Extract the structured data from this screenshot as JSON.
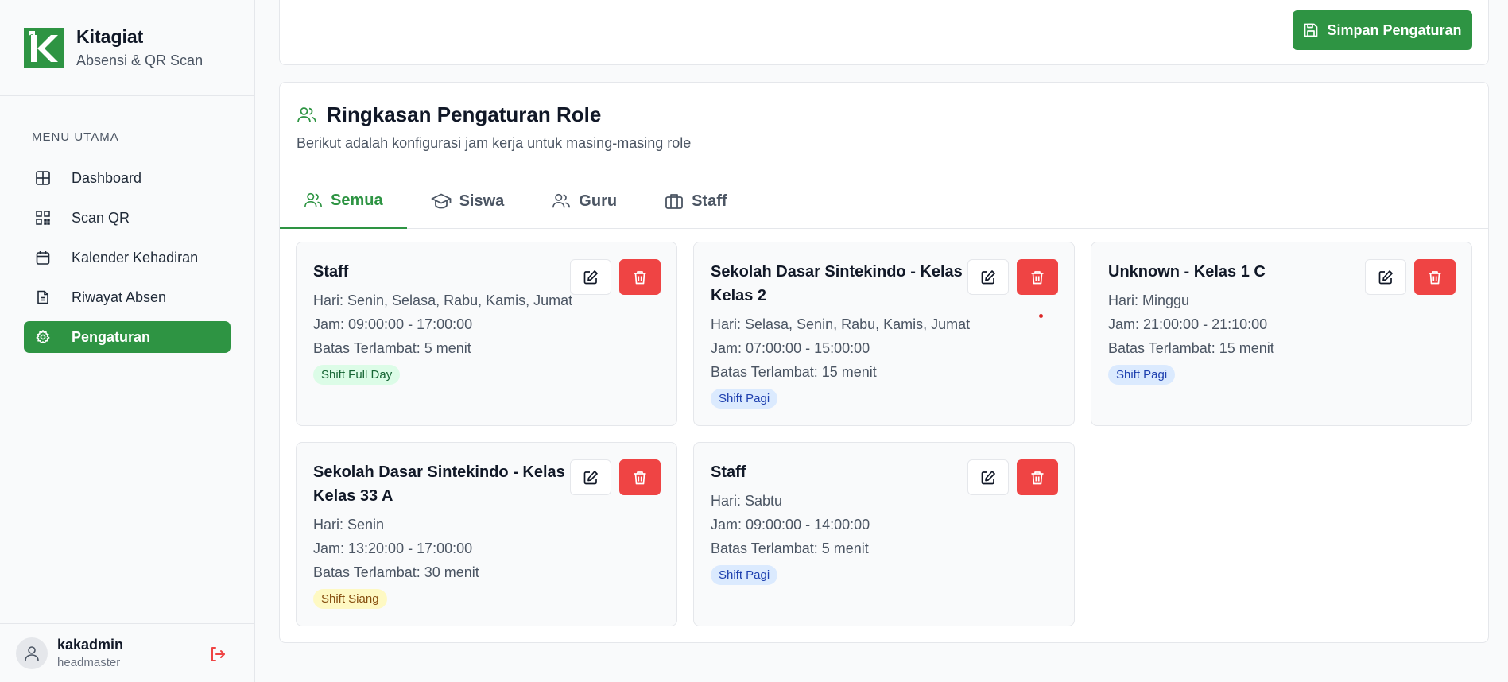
{
  "brand": {
    "name": "Kitagiat",
    "subtitle": "Absensi & QR Scan"
  },
  "menu": {
    "label": "MENU UTAMA",
    "items": [
      {
        "label": "Dashboard",
        "icon": "grid-icon"
      },
      {
        "label": "Scan QR",
        "icon": "qr-icon"
      },
      {
        "label": "Kalender Kehadiran",
        "icon": "calendar-icon"
      },
      {
        "label": "Riwayat Absen",
        "icon": "document-icon"
      },
      {
        "label": "Pengaturan",
        "icon": "gear-icon",
        "active": true
      }
    ]
  },
  "user": {
    "name": "kakadmin",
    "role": "headmaster"
  },
  "toolbar": {
    "save_label": "Simpan Pengaturan"
  },
  "summary": {
    "title": "Ringkasan Pengaturan Role",
    "description": "Berikut adalah konfigurasi jam kerja untuk masing-masing role",
    "tabs": [
      {
        "label": "Semua",
        "icon": "users-icon",
        "active": true
      },
      {
        "label": "Siswa",
        "icon": "graduation-cap-icon"
      },
      {
        "label": "Guru",
        "icon": "users-icon"
      },
      {
        "label": "Staff",
        "icon": "briefcase-icon"
      }
    ],
    "roles": [
      {
        "title": "Staff",
        "hari": "Hari: Senin, Selasa, Rabu, Kamis, Jumat",
        "jam": "Jam: 09:00:00 - 17:00:00",
        "batas": "Batas Terlambat: 5 menit",
        "badge": "Shift Full Day",
        "badge_color": "#dcfce7"
      },
      {
        "title": "Sekolah Dasar Sintekindo - Kelas Kelas 2",
        "hari": "Hari: Selasa, Senin, Rabu, Kamis, Jumat",
        "jam": "Jam: 07:00:00 - 15:00:00",
        "batas": "Batas Terlambat: 15 menit",
        "badge": "Shift Pagi",
        "badge_color": "#dbeafe"
      },
      {
        "title": "Unknown - Kelas 1 C",
        "hari": "Hari: Minggu",
        "jam": "Jam: 21:00:00 - 21:10:00",
        "batas": "Batas Terlambat: 15 menit",
        "badge": "Shift Pagi",
        "badge_color": "#dbeafe"
      },
      {
        "title": "Sekolah Dasar Sintekindo - Kelas Kelas 33 A",
        "hari": "Hari: Senin",
        "jam": "Jam: 13:20:00 - 17:00:00",
        "batas": "Batas Terlambat: 30 menit",
        "badge": "Shift Siang",
        "badge_color": "#fef9c3"
      },
      {
        "title": "Staff",
        "hari": "Hari: Sabtu",
        "jam": "Jam: 09:00:00 - 14:00:00",
        "batas": "Batas Terlambat: 5 menit",
        "badge": "Shift Pagi",
        "badge_color": "#dbeafe"
      }
    ]
  },
  "colors": {
    "accent": "#2e9443",
    "danger": "#ef4444"
  }
}
